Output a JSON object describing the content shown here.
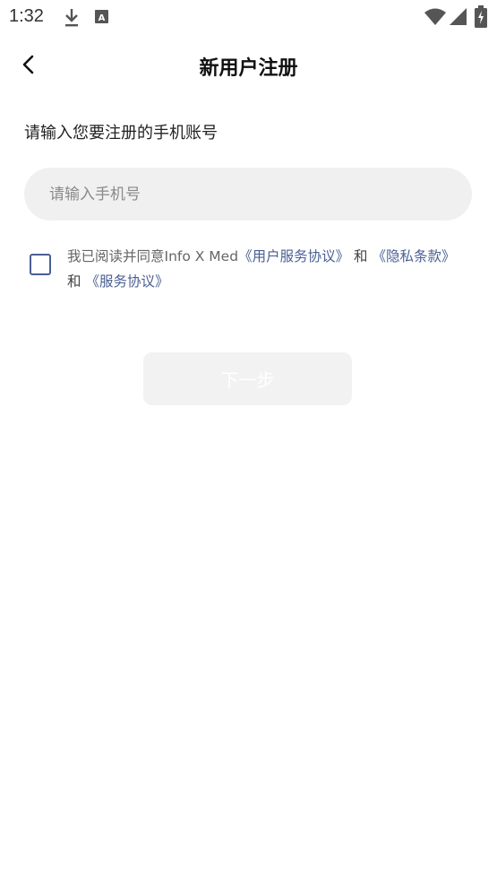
{
  "status_bar": {
    "time": "1:32",
    "icons": [
      "download-icon",
      "a-badge-icon",
      "wifi-icon",
      "signal-icon",
      "battery-icon"
    ]
  },
  "header": {
    "title": "新用户注册",
    "back_icon": "chevron-left-icon"
  },
  "form": {
    "prompt": "请输入您要注册的手机账号",
    "phone_placeholder": "请输入手机号",
    "phone_value": ""
  },
  "agreement": {
    "checked": false,
    "prefix": "我已阅读并同意Info X Med",
    "user_service_link": "《用户服务协议》",
    "and_1": " 和 ",
    "privacy_link": "《隐私条款》",
    "and_2": "和 ",
    "service_link": "《服务协议》"
  },
  "actions": {
    "next_label": "下一步"
  },
  "colors": {
    "accent": "#4a5f93",
    "input_bg": "#f0f0f0",
    "button_disabled_bg": "#f2f2f2"
  }
}
